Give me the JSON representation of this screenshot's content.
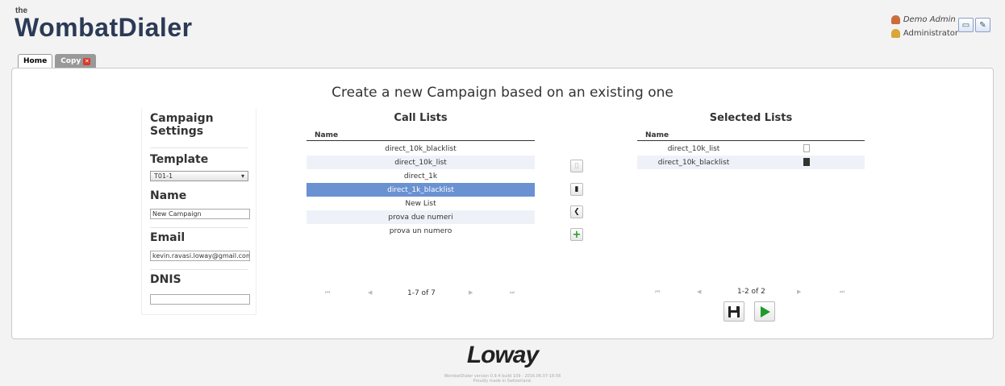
{
  "header": {
    "logo_small": "the",
    "logo_text": "WombatDialer",
    "user_name": "Demo Admin",
    "user_role": "Administrator"
  },
  "tabs": [
    {
      "label": "Home"
    },
    {
      "label": "Copy"
    }
  ],
  "page_title": "Create a new Campaign based on an existing one",
  "settings": {
    "heading": "Campaign Settings",
    "template_label": "Template",
    "template_value": "T01-1",
    "name_label": "Name",
    "name_value": "New Campaign",
    "email_label": "Email",
    "email_value": "kevin.ravasi.loway@gmail.com",
    "dnis_label": "DNIS",
    "dnis_value": ""
  },
  "call_lists": {
    "title": "Call Lists",
    "column": "Name",
    "rows": [
      "direct_10k_blacklist",
      "direct_10k_list",
      "direct_1k",
      "direct_1k_blacklist",
      "New List",
      "prova due numeri",
      "prova un numero"
    ],
    "selected_index": 3,
    "pager": "1-7 of 7"
  },
  "selected_lists": {
    "title": "Selected Lists",
    "column": "Name",
    "rows": [
      "direct_10k_list",
      "direct_10k_blacklist"
    ],
    "pager": "1-2 of 2"
  },
  "footer": {
    "brand": "Loway",
    "version": "WombatDialer version 0.9.4 build 109 - 2016.06.07-16:56",
    "tagline": "Proudly made in Switzerland."
  }
}
